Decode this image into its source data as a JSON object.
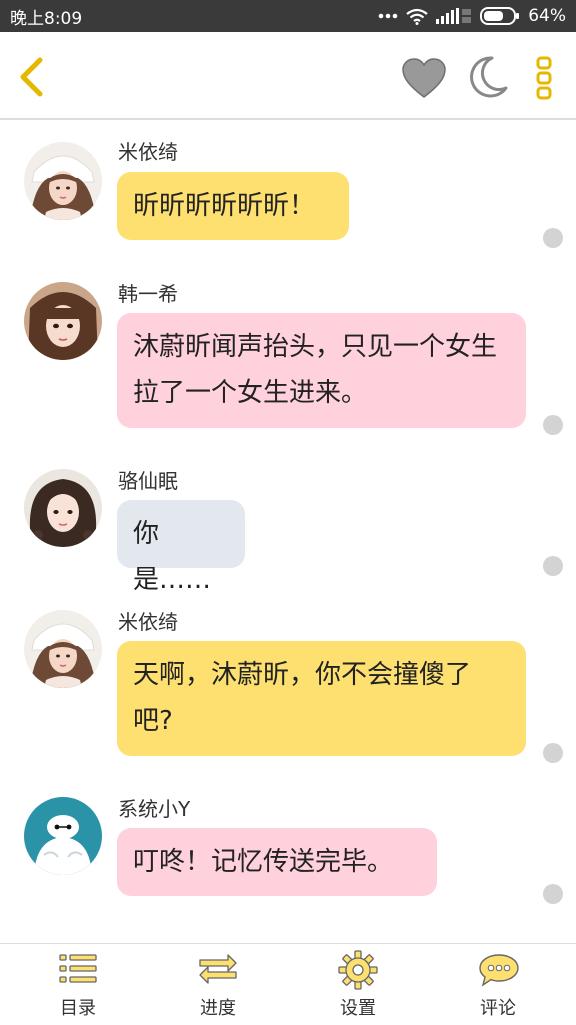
{
  "status_bar": {
    "time": "晚上8:09",
    "battery": "64%"
  },
  "nav": {
    "back_icon": "chevron-left-icon",
    "heart_icon": "heart-icon",
    "moon_icon": "moon-icon",
    "more_icon": "more-vertical-icon",
    "accent_color": "#e5b800"
  },
  "messages": [
    {
      "sender": "米依绮",
      "text": "昕昕昕昕昕昕！",
      "bubble_color": "#fde070"
    },
    {
      "sender": "韩一希",
      "text": "沐蔚昕闻声抬头，只见一个女生拉了一个女生进来。",
      "bubble_color": "#fed1dc"
    },
    {
      "sender": "骆仙眠",
      "text": "你是……",
      "bubble_color": "#e3e8ef"
    },
    {
      "sender": "米依绮",
      "text": "天啊，沐蔚昕，你不会撞傻了吧?",
      "bubble_color": "#fde070"
    },
    {
      "sender": "系统小Y",
      "text": "叮咚！记忆传送完毕。",
      "bubble_color": "#fed1dc"
    }
  ],
  "tabs": [
    {
      "label": "目录",
      "icon": "list-icon"
    },
    {
      "label": "进度",
      "icon": "swap-arrows-icon"
    },
    {
      "label": "设置",
      "icon": "gear-icon"
    },
    {
      "label": "评论",
      "icon": "comment-bubble-icon"
    }
  ]
}
